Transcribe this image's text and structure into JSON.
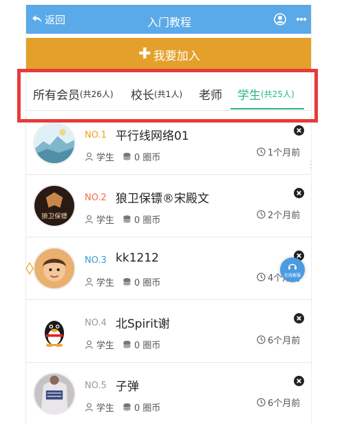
{
  "header": {
    "back_label": "返回",
    "title": "入门教程",
    "bg_color": "#5aa9e8"
  },
  "join_button": {
    "label": "我要加入",
    "bg_color": "#e3a02a"
  },
  "tabs": [
    {
      "label": "所有会员",
      "count": "(共26人)",
      "active": false
    },
    {
      "label": "校长",
      "count": "(共1人)",
      "active": false
    },
    {
      "label": "老师",
      "count": "",
      "active": false
    },
    {
      "label": "学生",
      "count": "(共25人)",
      "active": true
    }
  ],
  "accent_color": "#27b485",
  "members": [
    {
      "rank": "NO.1",
      "rank_color": "#f0a020",
      "name": "平行线网络01",
      "role": "学生",
      "coins": "0 圈币",
      "time": "1个月前"
    },
    {
      "rank": "NO.2",
      "rank_color": "#f26b3a",
      "name": "狼卫保镖®宋殿文",
      "role": "学生",
      "coins": "0 圈币",
      "time": "2个月前",
      "avatar_text": "狼卫保镖"
    },
    {
      "rank": "NO.3",
      "rank_color": "#3a9ad9",
      "name": "kk1212",
      "role": "学生",
      "coins": "0 圈币",
      "time": "4个月前"
    },
    {
      "rank": "NO.4",
      "rank_color": "#999999",
      "name": "北Spirit谢",
      "role": "学生",
      "coins": "0 圈币",
      "time": "6个月前"
    },
    {
      "rank": "NO.5",
      "rank_color": "#999999",
      "name": "子弹",
      "role": "学生",
      "coins": "0 圈币",
      "time": "6个月前"
    }
  ],
  "float_button": {
    "label": "在线客服"
  }
}
